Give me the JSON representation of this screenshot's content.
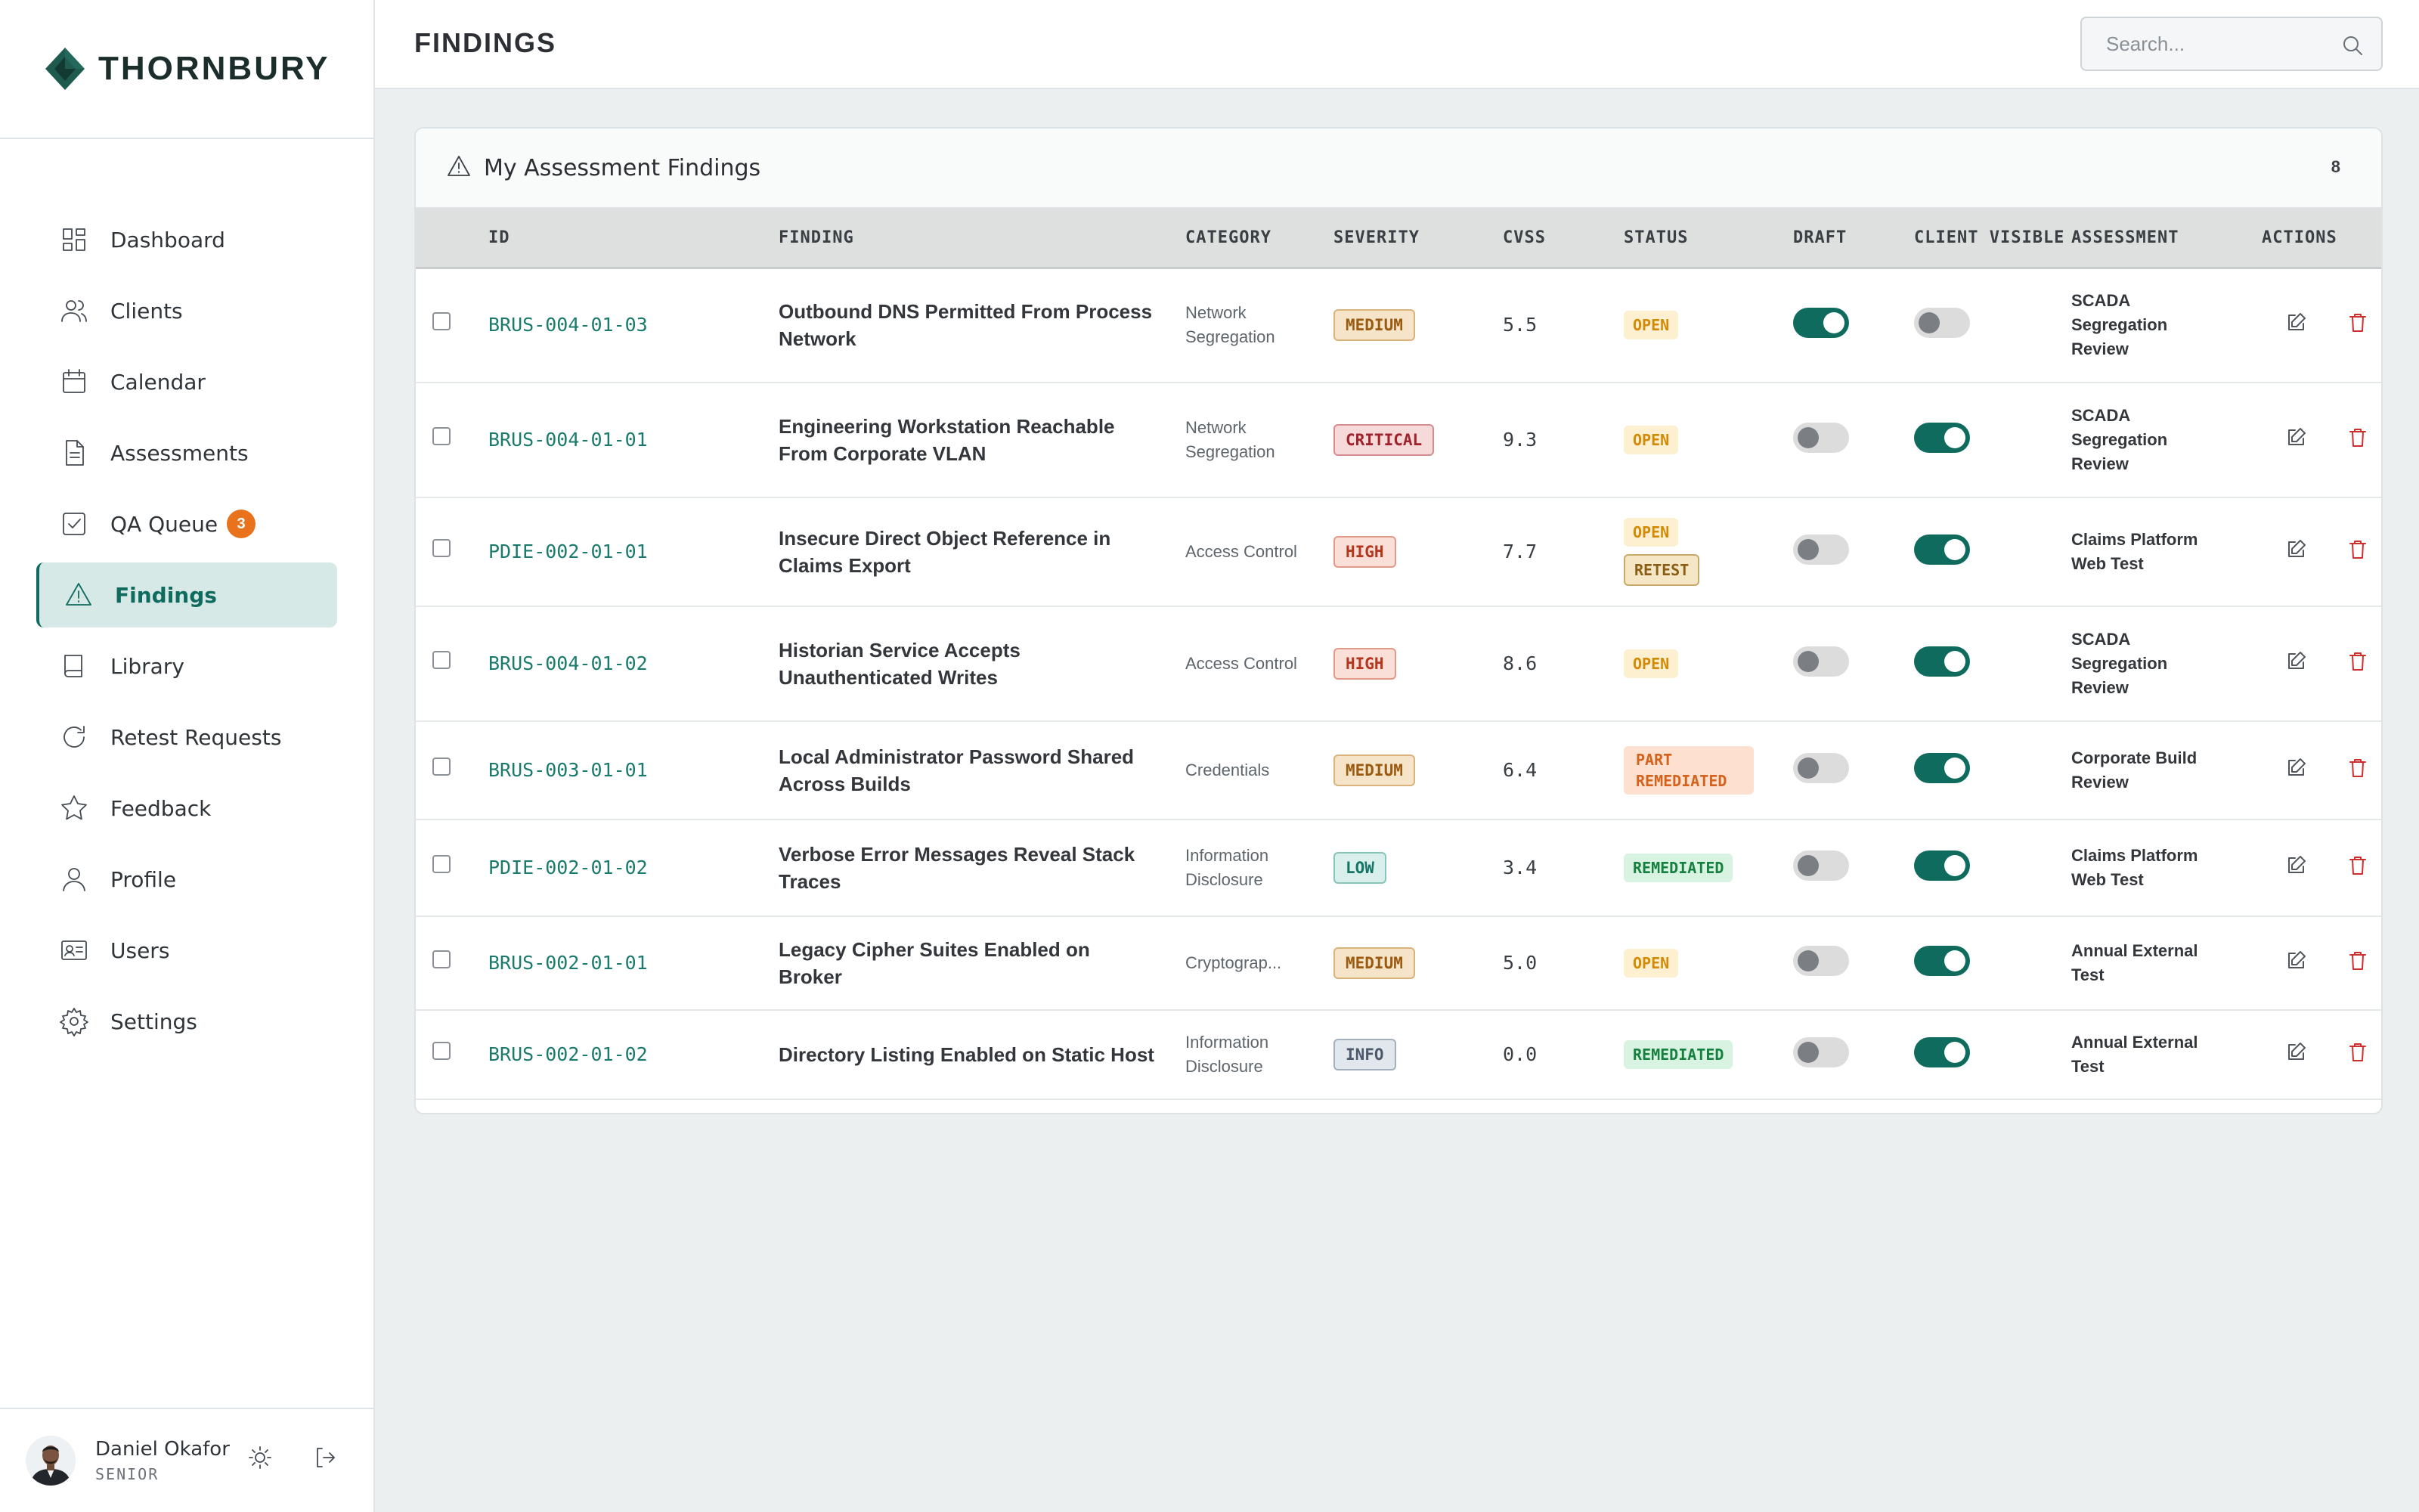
{
  "brand": {
    "name": "THORNBURY",
    "color": "#1f5a4f"
  },
  "nav": {
    "items": [
      {
        "label": "Dashboard",
        "icon": "grid-icon"
      },
      {
        "label": "Clients",
        "icon": "users-icon"
      },
      {
        "label": "Calendar",
        "icon": "calendar-icon"
      },
      {
        "label": "Assessments",
        "icon": "document-icon"
      },
      {
        "label": "QA Queue",
        "icon": "check-square-icon",
        "badge": "3"
      },
      {
        "label": "Findings",
        "icon": "warning-triangle-icon",
        "active": true
      },
      {
        "label": "Library",
        "icon": "book-icon"
      },
      {
        "label": "Retest Requests",
        "icon": "refresh-icon"
      },
      {
        "label": "Feedback",
        "icon": "star-icon"
      },
      {
        "label": "Profile",
        "icon": "user-icon"
      },
      {
        "label": "Users",
        "icon": "id-card-icon"
      },
      {
        "label": "Settings",
        "icon": "gear-icon"
      }
    ]
  },
  "user": {
    "name": "Daniel Okafor",
    "role": "SENIOR"
  },
  "header": {
    "title": "FINDINGS",
    "search_placeholder": "Search..."
  },
  "card": {
    "title": "My Assessment Findings",
    "count": "8"
  },
  "table": {
    "columns": {
      "id": "ID",
      "finding": "FINDING",
      "category": "CATEGORY",
      "severity": "SEVERITY",
      "cvss": "CVSS",
      "status": "STATUS",
      "draft": "DRAFT",
      "client_visible": "CLIENT VISIBLE",
      "assessment": "ASSESSMENT",
      "actions": "ACTIONS"
    },
    "rows": [
      {
        "id": "BRUS-004-01-03",
        "finding": "Outbound DNS Permitted From Process Network",
        "category": "Network Segregation",
        "severity": "MEDIUM",
        "cvss": "5.5",
        "status": [
          "OPEN"
        ],
        "draft": true,
        "client_visible": false,
        "assessment": "SCADA Segregation Review"
      },
      {
        "id": "BRUS-004-01-01",
        "finding": "Engineering Workstation Reachable From Corporate VLAN",
        "category": "Network Segregation",
        "severity": "CRITICAL",
        "cvss": "9.3",
        "status": [
          "OPEN"
        ],
        "draft": false,
        "client_visible": true,
        "assessment": "SCADA Segregation Review"
      },
      {
        "id": "PDIE-002-01-01",
        "finding": "Insecure Direct Object Reference in Claims Export",
        "category": "Access Control",
        "severity": "HIGH",
        "cvss": "7.7",
        "status": [
          "OPEN",
          "RETEST"
        ],
        "draft": false,
        "client_visible": true,
        "assessment": "Claims Platform Web Test"
      },
      {
        "id": "BRUS-004-01-02",
        "finding": "Historian Service Accepts Unauthenticated Writes",
        "category": "Access Control",
        "severity": "HIGH",
        "cvss": "8.6",
        "status": [
          "OPEN"
        ],
        "draft": false,
        "client_visible": true,
        "assessment": "SCADA Segregation Review"
      },
      {
        "id": "BRUS-003-01-01",
        "finding": "Local Administrator Password Shared Across Builds",
        "category": "Credentials",
        "severity": "MEDIUM",
        "cvss": "6.4",
        "status": [
          "PART REMEDIATED"
        ],
        "draft": false,
        "client_visible": true,
        "assessment": "Corporate Build Review"
      },
      {
        "id": "PDIE-002-01-02",
        "finding": "Verbose Error Messages Reveal Stack Traces",
        "category": "Information Disclosure",
        "severity": "LOW",
        "cvss": "3.4",
        "status": [
          "REMEDIATED"
        ],
        "draft": false,
        "client_visible": true,
        "assessment": "Claims Platform Web Test"
      },
      {
        "id": "BRUS-002-01-01",
        "finding": "Legacy Cipher Suites Enabled on Broker",
        "category": "Cryptograp...",
        "severity": "MEDIUM",
        "cvss": "5.0",
        "status": [
          "OPEN"
        ],
        "draft": false,
        "client_visible": true,
        "assessment": "Annual External Test"
      },
      {
        "id": "BRUS-002-01-02",
        "finding": "Directory Listing Enabled on Static Host",
        "category": "Information Disclosure",
        "severity": "INFO",
        "cvss": "0.0",
        "status": [
          "REMEDIATED"
        ],
        "draft": false,
        "client_visible": true,
        "assessment": "Annual External Test"
      }
    ]
  },
  "colors": {
    "accent": "#0f6b5e",
    "badge": "#e9731d",
    "delete": "#cf2e2e"
  }
}
